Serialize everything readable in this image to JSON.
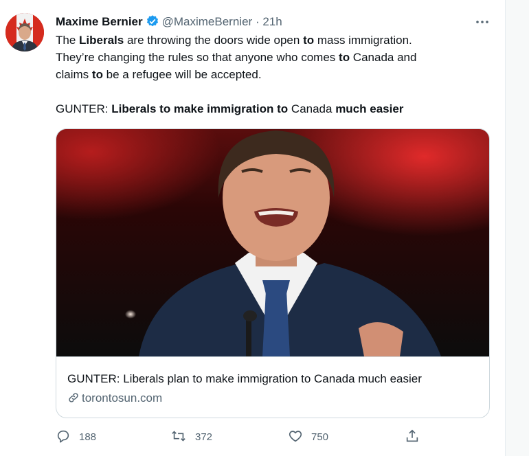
{
  "author": {
    "name": "Maxime Bernier",
    "handle": "@MaximeBernier",
    "separator": "·",
    "time": "21h",
    "verified": true
  },
  "tweet_text": {
    "l1_a": "The ",
    "l1_b": "Liberals",
    "l1_c": " are throwing the doors wide open ",
    "l1_d": "to",
    "l1_e": " mass immigration.",
    "l2_a": "They’re changing the rules so that anyone who comes ",
    "l2_b": "to",
    "l2_c": " Canada and",
    "l3_a": "claims ",
    "l3_b": "to",
    "l3_c": " be a refugee will be accepted.",
    "l5_a": "GUNTER: ",
    "l5_b": "Liberals to make immigration to",
    "l5_c": " Canada ",
    "l5_d": "much easier"
  },
  "link_card": {
    "title": "GUNTER: Liberals plan to make immigration to Canada much easier",
    "domain": "torontosun.com"
  },
  "actions": {
    "replies": "188",
    "retweets": "372",
    "likes": "750"
  },
  "colors": {
    "verified": "#1d9bf0",
    "secondary_text": "#536471",
    "border": "#cfd9de"
  },
  "icons": [
    "verified-badge-icon",
    "more-icon",
    "link-icon",
    "reply-icon",
    "retweet-icon",
    "like-icon",
    "share-icon"
  ]
}
